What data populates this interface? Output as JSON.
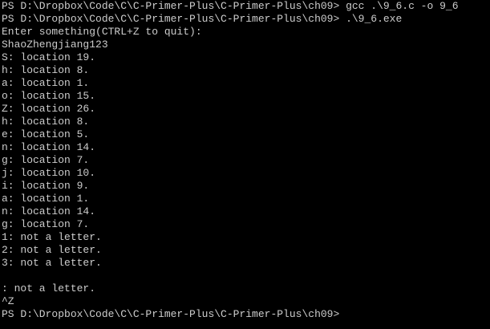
{
  "terminal": {
    "colors": {
      "background": "#000000",
      "text": "#cccccc"
    },
    "lines": [
      "PS D:\\Dropbox\\Code\\C\\C-Primer-Plus\\C-Primer-Plus\\ch09> gcc .\\9_6.c -o 9_6",
      "PS D:\\Dropbox\\Code\\C\\C-Primer-Plus\\C-Primer-Plus\\ch09> .\\9_6.exe",
      "Enter something(CTRL+Z to quit):",
      "ShaoZhengjiang123",
      "S: location 19.",
      "h: location 8.",
      "a: location 1.",
      "o: location 15.",
      "Z: location 26.",
      "h: location 8.",
      "e: location 5.",
      "n: location 14.",
      "g: location 7.",
      "j: location 10.",
      "i: location 9.",
      "a: location 1.",
      "n: location 14.",
      "g: location 7.",
      "1: not a letter.",
      "2: not a letter.",
      "3: not a letter.",
      "",
      ": not a letter.",
      "^Z",
      "PS D:\\Dropbox\\Code\\C\\C-Primer-Plus\\C-Primer-Plus\\ch09>"
    ]
  }
}
